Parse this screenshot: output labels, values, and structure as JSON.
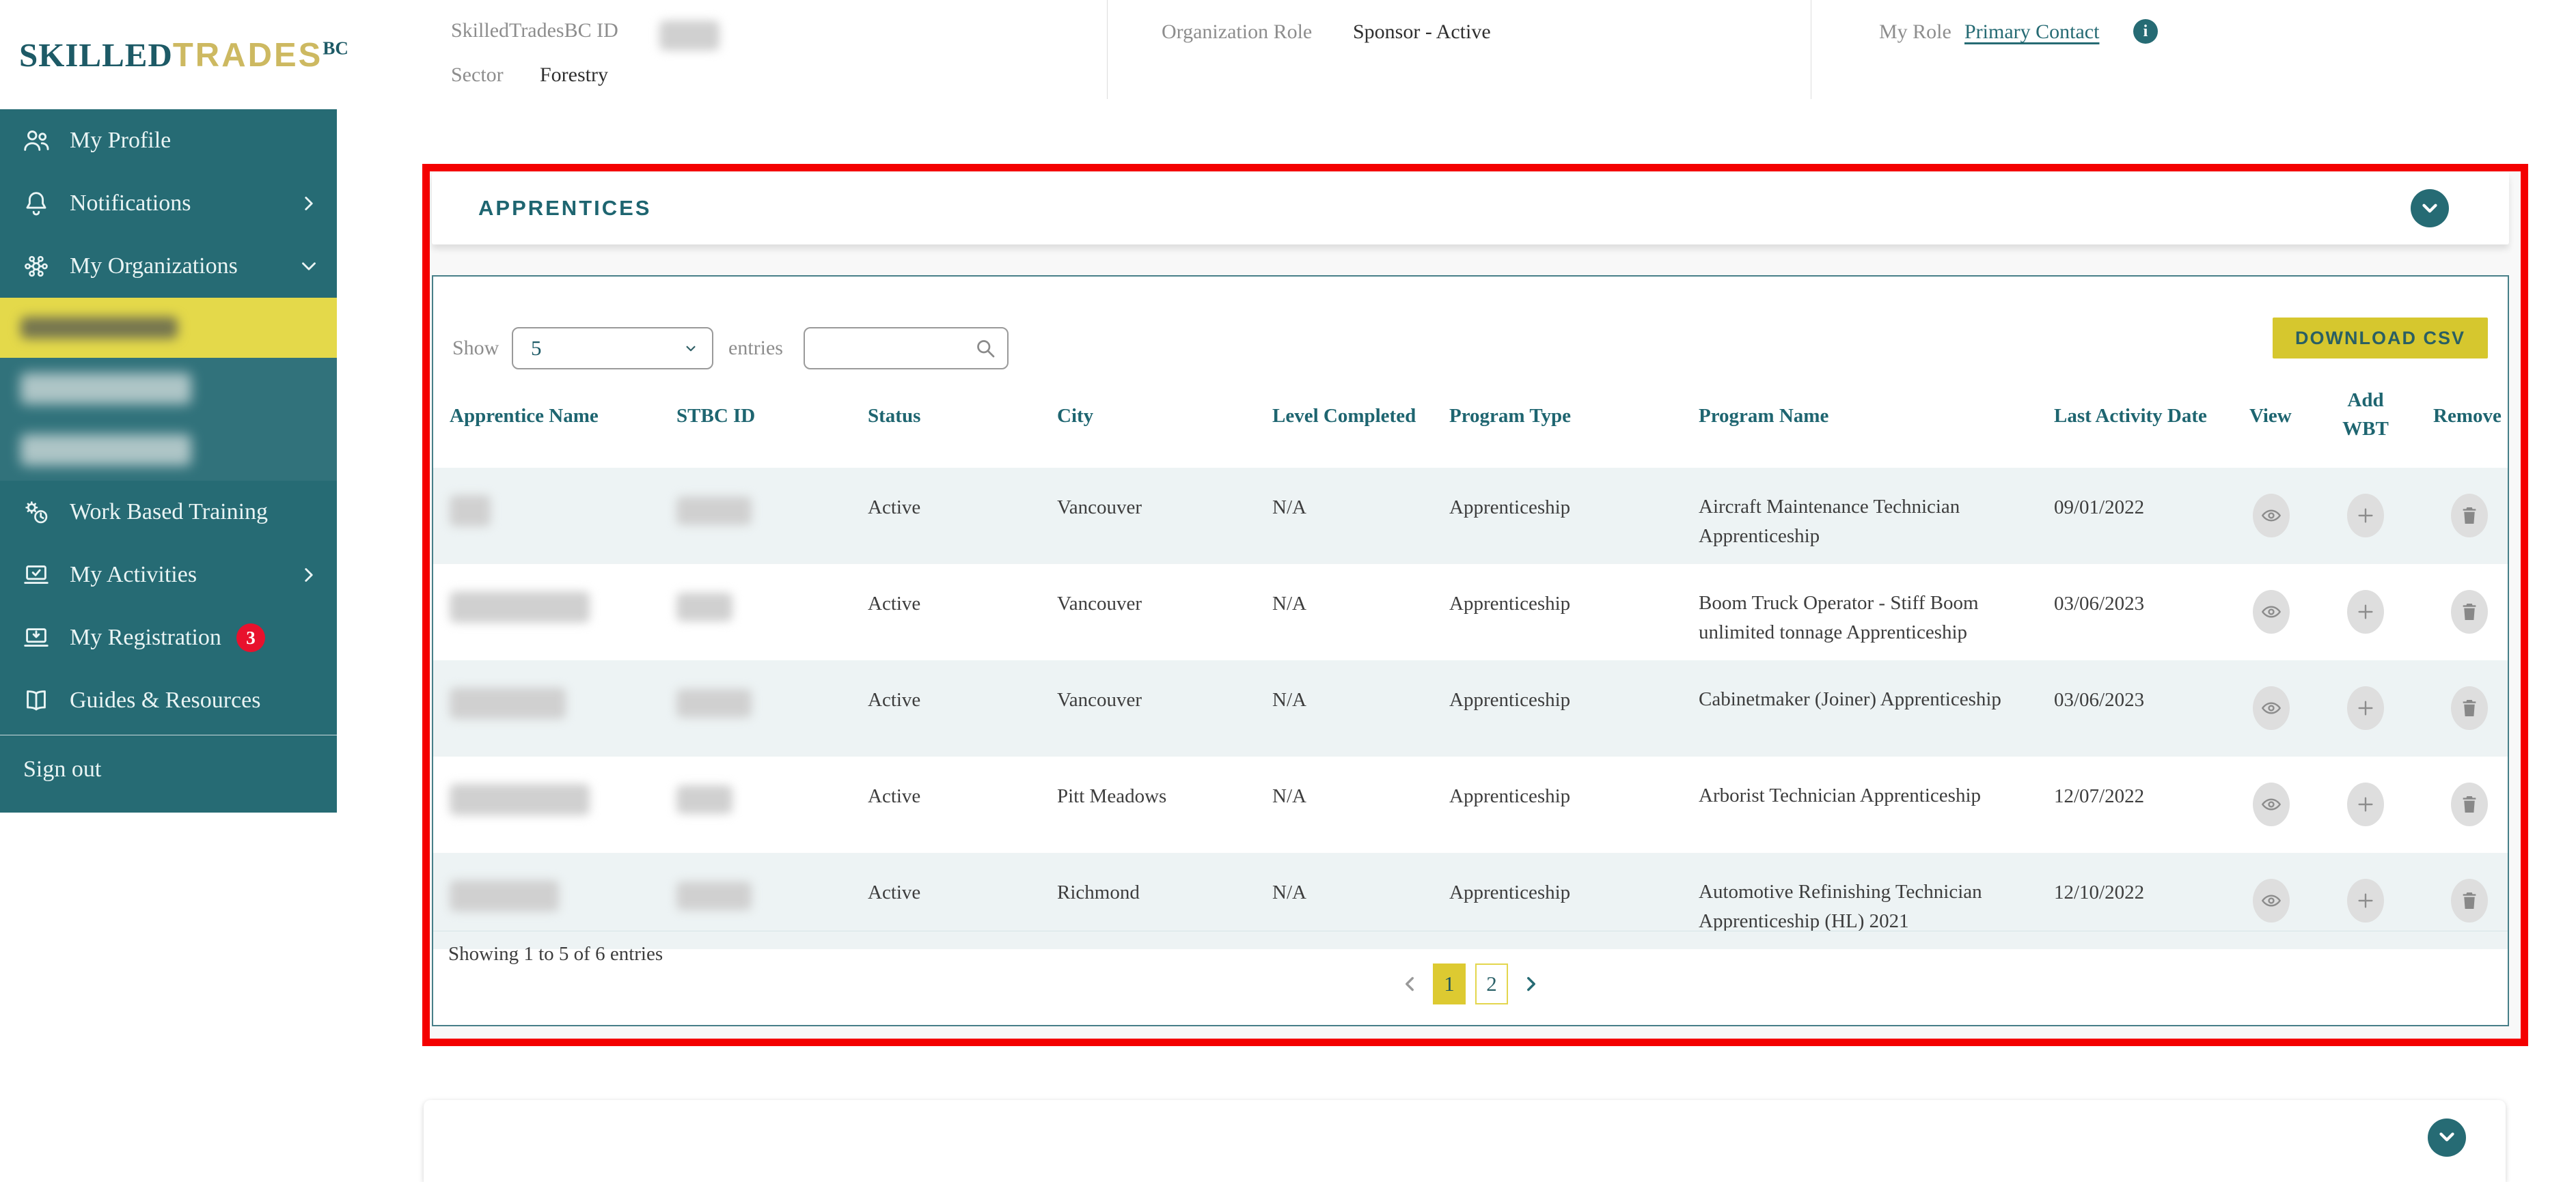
{
  "colors": {
    "teal": "#266b74",
    "teal_dark": "#1d5a66",
    "header_teal": "#1e6570",
    "yellow": "#ddca31",
    "yellow_light": "#e4d94a",
    "yellow_strong": "#d6c72e",
    "gold_logo": "#cdb961",
    "red_annotation": "#f40000",
    "badge_red": "#e8112d",
    "row_alt": "#edf3f4",
    "card_border": "#477f88",
    "text_dark": "#2f2f2f",
    "text_gray": "#8d8d8d"
  },
  "brand": {
    "skilled": "SKILLED",
    "trades": "TRADES",
    "bc": "BC"
  },
  "top_header": {
    "stbc_id_label": "SkilledTradesBC ID",
    "sector_label": "Sector",
    "sector_value": "Forestry",
    "org_role_label": "Organization Role",
    "org_role_value": "Sponsor - Active",
    "my_role_label": "My Role",
    "my_role_value": "Primary Contact",
    "info_glyph": "i"
  },
  "sidebar": {
    "items": [
      {
        "label": "My Profile"
      },
      {
        "label": "Notifications"
      },
      {
        "label": "My Organizations"
      },
      {
        "label": "Work Based Training"
      },
      {
        "label": "My Activities"
      },
      {
        "label": "My Registration",
        "badge": "3"
      },
      {
        "label": "Guides & Resources"
      }
    ],
    "sign_out": "Sign out"
  },
  "panel": {
    "title": "APPRENTICES",
    "show_label": "Show",
    "entries_label": "entries",
    "page_size": "5",
    "download_csv": "DOWNLOAD CSV",
    "table": {
      "columns": [
        "Apprentice Name",
        "STBC ID",
        "Status",
        "City",
        "Level Completed",
        "Program Type",
        "Program Name",
        "Last Activity Date",
        "View",
        "Add WBT",
        "Remove"
      ],
      "rows": [
        {
          "status": "Active",
          "city": "Vancouver",
          "level": "N/A",
          "type": "Apprenticeship",
          "program": "Aircraft Maintenance Technician Apprenticeship",
          "date": "09/01/2022"
        },
        {
          "status": "Active",
          "city": "Vancouver",
          "level": "N/A",
          "type": "Apprenticeship",
          "program": "Boom Truck Operator - Stiff Boom unlimited tonnage Apprenticeship",
          "date": "03/06/2023"
        },
        {
          "status": "Active",
          "city": "Vancouver",
          "level": "N/A",
          "type": "Apprenticeship",
          "program": "Cabinetmaker (Joiner) Apprenticeship",
          "date": "03/06/2023"
        },
        {
          "status": "Active",
          "city": "Pitt Meadows",
          "level": "N/A",
          "type": "Apprenticeship",
          "program": "Arborist Technician Apprenticeship",
          "date": "12/07/2022"
        },
        {
          "status": "Active",
          "city": "Richmond",
          "level": "N/A",
          "type": "Apprenticeship",
          "program": "Automotive Refinishing Technician Apprenticeship (HL) 2021",
          "date": "12/10/2022"
        }
      ]
    },
    "footer": {
      "showing": "Showing 1 to 5 of 6 entries",
      "pages": [
        "1",
        "2"
      ],
      "active_page": "1"
    }
  }
}
